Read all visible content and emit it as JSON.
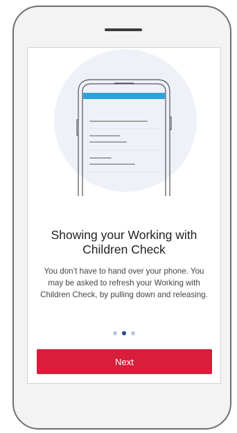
{
  "onboarding": {
    "title": "Showing your Working with Children Check",
    "body": "You don’t have to hand over your phone. You may be asked to refresh your Working with Children Check, by pulling down and releasing.",
    "pagination": {
      "total": 3,
      "active_index": 1
    },
    "next_label": "Next"
  },
  "colors": {
    "accent": "#d81e3b",
    "illustration_header": "#2ba3dc",
    "dot_active": "#2b4a85",
    "dot_inactive": "#b5c7e8"
  },
  "icons": {
    "illustration": "phone-refresh-illustration"
  }
}
